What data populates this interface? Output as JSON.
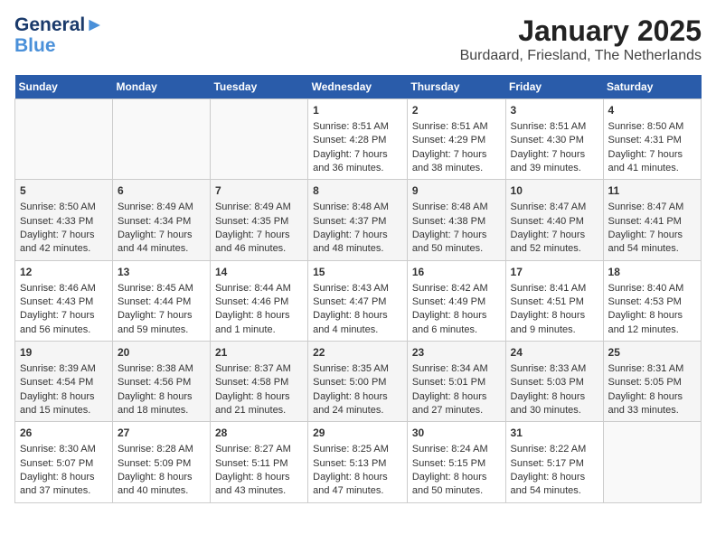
{
  "logo": {
    "line1": "General",
    "line2": "Blue"
  },
  "title": "January 2025",
  "subtitle": "Burdaard, Friesland, The Netherlands",
  "days_of_week": [
    "Sunday",
    "Monday",
    "Tuesday",
    "Wednesday",
    "Thursday",
    "Friday",
    "Saturday"
  ],
  "weeks": [
    [
      {
        "day": "",
        "content": ""
      },
      {
        "day": "",
        "content": ""
      },
      {
        "day": "",
        "content": ""
      },
      {
        "day": "1",
        "content": "Sunrise: 8:51 AM\nSunset: 4:28 PM\nDaylight: 7 hours and 36 minutes."
      },
      {
        "day": "2",
        "content": "Sunrise: 8:51 AM\nSunset: 4:29 PM\nDaylight: 7 hours and 38 minutes."
      },
      {
        "day": "3",
        "content": "Sunrise: 8:51 AM\nSunset: 4:30 PM\nDaylight: 7 hours and 39 minutes."
      },
      {
        "day": "4",
        "content": "Sunrise: 8:50 AM\nSunset: 4:31 PM\nDaylight: 7 hours and 41 minutes."
      }
    ],
    [
      {
        "day": "5",
        "content": "Sunrise: 8:50 AM\nSunset: 4:33 PM\nDaylight: 7 hours and 42 minutes."
      },
      {
        "day": "6",
        "content": "Sunrise: 8:49 AM\nSunset: 4:34 PM\nDaylight: 7 hours and 44 minutes."
      },
      {
        "day": "7",
        "content": "Sunrise: 8:49 AM\nSunset: 4:35 PM\nDaylight: 7 hours and 46 minutes."
      },
      {
        "day": "8",
        "content": "Sunrise: 8:48 AM\nSunset: 4:37 PM\nDaylight: 7 hours and 48 minutes."
      },
      {
        "day": "9",
        "content": "Sunrise: 8:48 AM\nSunset: 4:38 PM\nDaylight: 7 hours and 50 minutes."
      },
      {
        "day": "10",
        "content": "Sunrise: 8:47 AM\nSunset: 4:40 PM\nDaylight: 7 hours and 52 minutes."
      },
      {
        "day": "11",
        "content": "Sunrise: 8:47 AM\nSunset: 4:41 PM\nDaylight: 7 hours and 54 minutes."
      }
    ],
    [
      {
        "day": "12",
        "content": "Sunrise: 8:46 AM\nSunset: 4:43 PM\nDaylight: 7 hours and 56 minutes."
      },
      {
        "day": "13",
        "content": "Sunrise: 8:45 AM\nSunset: 4:44 PM\nDaylight: 7 hours and 59 minutes."
      },
      {
        "day": "14",
        "content": "Sunrise: 8:44 AM\nSunset: 4:46 PM\nDaylight: 8 hours and 1 minute."
      },
      {
        "day": "15",
        "content": "Sunrise: 8:43 AM\nSunset: 4:47 PM\nDaylight: 8 hours and 4 minutes."
      },
      {
        "day": "16",
        "content": "Sunrise: 8:42 AM\nSunset: 4:49 PM\nDaylight: 8 hours and 6 minutes."
      },
      {
        "day": "17",
        "content": "Sunrise: 8:41 AM\nSunset: 4:51 PM\nDaylight: 8 hours and 9 minutes."
      },
      {
        "day": "18",
        "content": "Sunrise: 8:40 AM\nSunset: 4:53 PM\nDaylight: 8 hours and 12 minutes."
      }
    ],
    [
      {
        "day": "19",
        "content": "Sunrise: 8:39 AM\nSunset: 4:54 PM\nDaylight: 8 hours and 15 minutes."
      },
      {
        "day": "20",
        "content": "Sunrise: 8:38 AM\nSunset: 4:56 PM\nDaylight: 8 hours and 18 minutes."
      },
      {
        "day": "21",
        "content": "Sunrise: 8:37 AM\nSunset: 4:58 PM\nDaylight: 8 hours and 21 minutes."
      },
      {
        "day": "22",
        "content": "Sunrise: 8:35 AM\nSunset: 5:00 PM\nDaylight: 8 hours and 24 minutes."
      },
      {
        "day": "23",
        "content": "Sunrise: 8:34 AM\nSunset: 5:01 PM\nDaylight: 8 hours and 27 minutes."
      },
      {
        "day": "24",
        "content": "Sunrise: 8:33 AM\nSunset: 5:03 PM\nDaylight: 8 hours and 30 minutes."
      },
      {
        "day": "25",
        "content": "Sunrise: 8:31 AM\nSunset: 5:05 PM\nDaylight: 8 hours and 33 minutes."
      }
    ],
    [
      {
        "day": "26",
        "content": "Sunrise: 8:30 AM\nSunset: 5:07 PM\nDaylight: 8 hours and 37 minutes."
      },
      {
        "day": "27",
        "content": "Sunrise: 8:28 AM\nSunset: 5:09 PM\nDaylight: 8 hours and 40 minutes."
      },
      {
        "day": "28",
        "content": "Sunrise: 8:27 AM\nSunset: 5:11 PM\nDaylight: 8 hours and 43 minutes."
      },
      {
        "day": "29",
        "content": "Sunrise: 8:25 AM\nSunset: 5:13 PM\nDaylight: 8 hours and 47 minutes."
      },
      {
        "day": "30",
        "content": "Sunrise: 8:24 AM\nSunset: 5:15 PM\nDaylight: 8 hours and 50 minutes."
      },
      {
        "day": "31",
        "content": "Sunrise: 8:22 AM\nSunset: 5:17 PM\nDaylight: 8 hours and 54 minutes."
      },
      {
        "day": "",
        "content": ""
      }
    ]
  ]
}
